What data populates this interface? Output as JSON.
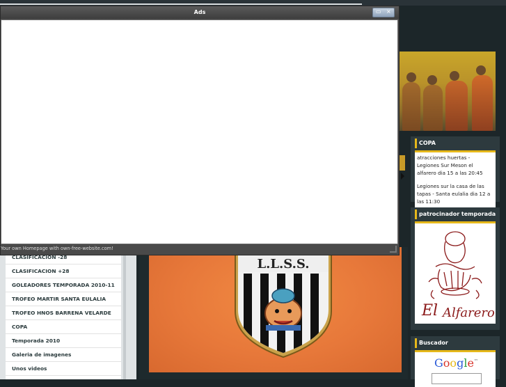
{
  "popup": {
    "title": "Ads",
    "footer_text": "Your own Homepage with own-free-website.com!",
    "controls": {
      "maximize_glyph": "▭",
      "close_glyph": "×"
    }
  },
  "sidebar_right": {
    "copa": {
      "title": "COPA",
      "entries": [
        "atracciones huertas - Legiones Sur Meson el alfarero dia 15 a las 20:45",
        "Legiones sur la casa de las tapas - Santa eulalia dia 12 a las 11:30"
      ]
    },
    "sponsor": {
      "title": "patrocinador temporada",
      "logo_alt": "El Alfarero"
    },
    "search": {
      "title": "Buscador",
      "google_word": "Google",
      "tm": "™"
    }
  },
  "menu": {
    "items": [
      "CLASIFICACION -28",
      "CLASIFICACION +28",
      "GOLEADORES TEMPORADA 2010-11",
      "TROFEO MARTIR SANTA EULALIA",
      "TROFEO HNOS BARRENA VELARDE",
      "COPA",
      "Temporada 2010",
      "Galeria de imagenes",
      "Unos videos"
    ]
  },
  "center": {
    "crest_text": "L.L.S.S."
  },
  "colors": {
    "accent": "#e6b81a",
    "sidebar_bg": "#2d3a3e",
    "photo_orange": "#e7783a"
  }
}
